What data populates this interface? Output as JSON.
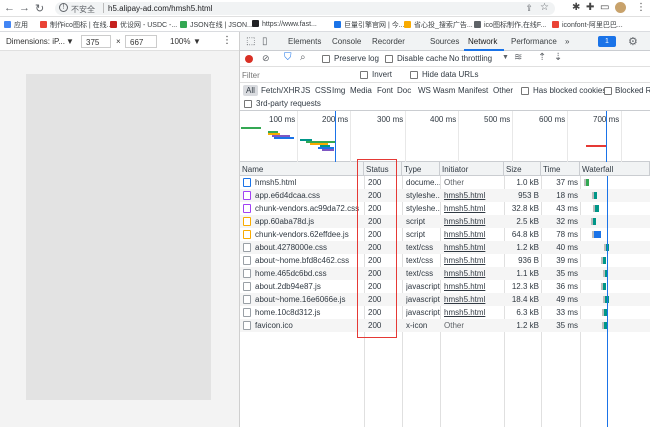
{
  "browser": {
    "insecure_label": "不安全",
    "url": "h5.alipay-ad.com/hmsh5.html",
    "bookmarks": [
      {
        "label": "应用",
        "color": "#4285f4"
      },
      {
        "label": "制作ico图标 | 在线...",
        "color": "#ea4335"
      },
      {
        "label": "优设网 - USDC -...",
        "color": "#c5221f"
      },
      {
        "label": "JSON在线 | JSON...",
        "color": "#34a853"
      },
      {
        "label": "https://www.fast...",
        "color": "#202124"
      },
      {
        "label": "巨量引擎官网 | 今...",
        "color": "#1a73e8"
      },
      {
        "label": "省心投_搜索广告...",
        "color": "#f9ab00"
      },
      {
        "label": "ico图标制作,在线F...",
        "color": "#5f6368"
      },
      {
        "label": "iconfont-阿里巴巴...",
        "color": "#ea4335"
      }
    ]
  },
  "device_toolbar": {
    "dimensions_label": "Dimensions: iP...",
    "width": "375",
    "times": "×",
    "height": "667",
    "zoom": "100%"
  },
  "devtools": {
    "tabs": [
      "Elements",
      "Console",
      "Recorder",
      "Sources",
      "Network",
      "Performance",
      "»"
    ],
    "active_tab": "Network",
    "issues_count": "1",
    "toolbar": {
      "preserve_log": "Preserve log",
      "disable_cache": "Disable cache",
      "throttling": "No throttling"
    },
    "filter": {
      "placeholder": "Filter",
      "invert": "Invert",
      "hide_data_urls": "Hide data URLs"
    },
    "types": [
      "All",
      "Fetch/XHR",
      "JS",
      "CSS",
      "Img",
      "Media",
      "Font",
      "Doc",
      "WS",
      "Wasm",
      "Manifest",
      "Other"
    ],
    "has_blocked_cookies": "Has blocked cookies",
    "blocked_requests": "Blocked Re",
    "third_party": "3rd-party requests",
    "overview_ticks": [
      "100 ms",
      "200 ms",
      "300 ms",
      "400 ms",
      "500 ms",
      "600 ms",
      "700 ms"
    ],
    "columns": [
      "Name",
      "Status",
      "Type",
      "Initiator",
      "Size",
      "Time",
      "Waterfall"
    ],
    "requests": [
      {
        "name": "hmsh5.html",
        "status": "200",
        "type": "docume...",
        "initiator": "Other",
        "size": "1.0 kB",
        "time": "37 ms",
        "kind": "doc"
      },
      {
        "name": "app.e6d4dcaa.css",
        "status": "200",
        "type": "styleshe...",
        "initiator": "hmsh5.html",
        "size": "953 B",
        "time": "18 ms",
        "kind": "css"
      },
      {
        "name": "chunk-vendors.ac99da72.css",
        "status": "200",
        "type": "styleshe...",
        "initiator": "hmsh5.html",
        "size": "32.8 kB",
        "time": "43 ms",
        "kind": "css"
      },
      {
        "name": "app.60aba78d.js",
        "status": "200",
        "type": "script",
        "initiator": "hmsh5.html",
        "size": "2.5 kB",
        "time": "32 ms",
        "kind": "js"
      },
      {
        "name": "chunk-vendors.62effdee.js",
        "status": "200",
        "type": "script",
        "initiator": "hmsh5.html",
        "size": "64.8 kB",
        "time": "78 ms",
        "kind": "js"
      },
      {
        "name": "about.4278000e.css",
        "status": "200",
        "type": "text/css",
        "initiator": "hmsh5.html",
        "size": "1.2 kB",
        "time": "40 ms",
        "kind": "other"
      },
      {
        "name": "about~home.bfd8c462.css",
        "status": "200",
        "type": "text/css",
        "initiator": "hmsh5.html",
        "size": "936 B",
        "time": "39 ms",
        "kind": "other"
      },
      {
        "name": "home.465dc6bd.css",
        "status": "200",
        "type": "text/css",
        "initiator": "hmsh5.html",
        "size": "1.1 kB",
        "time": "35 ms",
        "kind": "other"
      },
      {
        "name": "about.2db94e87.js",
        "status": "200",
        "type": "javascript",
        "initiator": "hmsh5.html",
        "size": "12.3 kB",
        "time": "36 ms",
        "kind": "other"
      },
      {
        "name": "about~home.16e6066e.js",
        "status": "200",
        "type": "javascript",
        "initiator": "hmsh5.html",
        "size": "18.4 kB",
        "time": "49 ms",
        "kind": "other"
      },
      {
        "name": "home.10c8d312.js",
        "status": "200",
        "type": "javascript",
        "initiator": "hmsh5.html",
        "size": "6.3 kB",
        "time": "33 ms",
        "kind": "other"
      },
      {
        "name": "favicon.ico",
        "status": "200",
        "type": "x-icon",
        "initiator": "Other",
        "size": "1.2 kB",
        "time": "35 ms",
        "kind": "other"
      }
    ]
  },
  "colors": {
    "accent": "#1a73e8",
    "record": "#d93025",
    "highlight": "#e53935",
    "waterfall_green": "#34a853",
    "waterfall_teal": "#009688",
    "waterfall_blue": "#1a73e8"
  }
}
